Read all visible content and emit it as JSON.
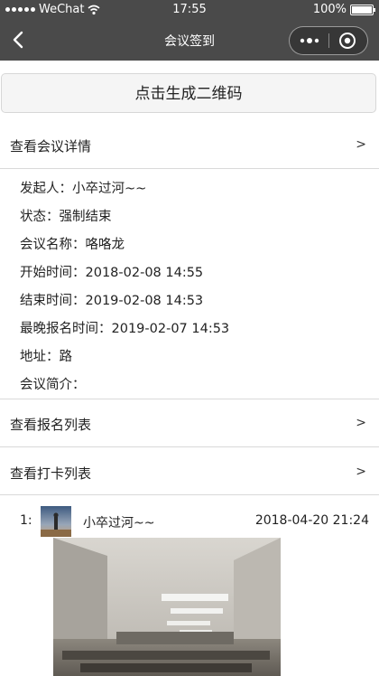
{
  "status_bar": {
    "carrier": "WeChat",
    "time": "17:55",
    "battery": "100%",
    "battery_level": 1.0
  },
  "nav": {
    "title": "会议签到",
    "back_icon": "chevron-left-icon",
    "more_icon": "more-dots-icon",
    "home_icon": "circle-target-icon"
  },
  "qr_button": {
    "label": "点击生成二维码"
  },
  "sections": {
    "details_header": {
      "label": "查看会议详情",
      "chevron": ">"
    },
    "signup_list": {
      "label": "查看报名列表",
      "chevron": ">"
    },
    "checkin_list": {
      "label": "查看打卡列表",
      "chevron": ">"
    }
  },
  "meeting": {
    "initiator": "发起人：小卒过河~~",
    "state": "状态：强制结束",
    "name": "会议名称：咯咯龙",
    "start": "开始时间：2018-02-08 14:55",
    "end": "结束时间：2019-02-08 14:53",
    "deadline": "最晚报名时间：2019-02-07 14:53",
    "address": "地址：路",
    "intro": "会议简介："
  },
  "checkins": [
    {
      "index": "1:",
      "user": "小卒过河~~",
      "time": "2018-04-20 21:24"
    }
  ],
  "colors": {
    "nav_bg": "#4a4a4a",
    "button_bg": "#f5f5f5",
    "divider": "#d9d9d9"
  }
}
